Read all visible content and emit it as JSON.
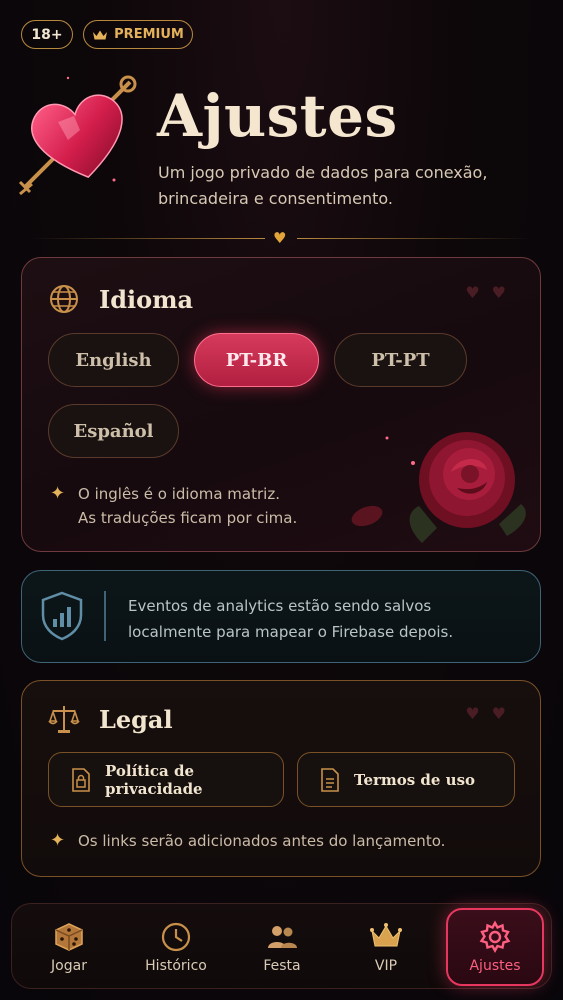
{
  "badges": {
    "age": "18+",
    "premium": "PREMIUM"
  },
  "header": {
    "title": "Ajustes",
    "subtitle": "Um jogo privado de dados para conexão, brincadeira e consentimento."
  },
  "language_card": {
    "title": "Idioma",
    "options": [
      {
        "label": "English",
        "selected": false
      },
      {
        "label": "PT-BR",
        "selected": true
      },
      {
        "label": "PT-PT",
        "selected": false
      },
      {
        "label": "Español",
        "selected": false
      }
    ],
    "note_line1": "O inglês é o idioma matriz.",
    "note_line2": "As traduções ficam por cima."
  },
  "analytics_card": {
    "text": "Eventos de analytics estão sendo salvos localmente para mapear o Firebase depois."
  },
  "legal_card": {
    "title": "Legal",
    "privacy_button": "Política de privacidade",
    "terms_button": "Termos de uso",
    "note": "Os links serão adicionados antes do lançamento."
  },
  "bottom_nav": {
    "items": [
      {
        "label": "Jogar",
        "icon": "dice-icon",
        "active": false
      },
      {
        "label": "Histórico",
        "icon": "clock-icon",
        "active": false
      },
      {
        "label": "Festa",
        "icon": "people-icon",
        "active": false
      },
      {
        "label": "VIP",
        "icon": "crown-icon",
        "active": false
      },
      {
        "label": "Ajustes",
        "icon": "gear-icon",
        "active": true
      }
    ]
  },
  "colors": {
    "accent_pink": "#e8375f",
    "gold": "#b8893f",
    "background": "#0d0709",
    "analytics_border": "#3e6476"
  }
}
